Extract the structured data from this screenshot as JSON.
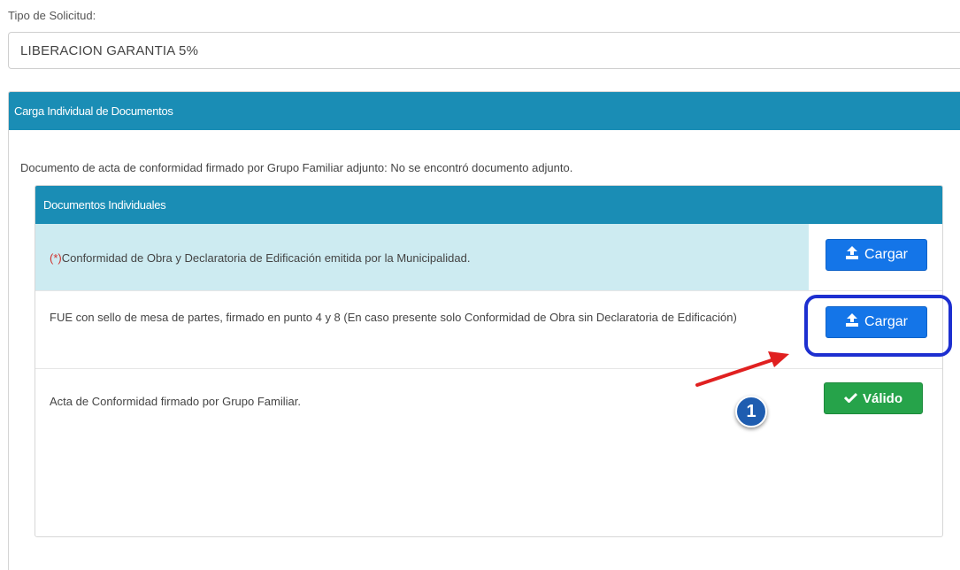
{
  "form": {
    "tipo_label": "Tipo de Solicitud:",
    "tipo_value": "LIBERACION GARANTIA 5%"
  },
  "carga_panel": {
    "title": "Carga Individual de Documentos",
    "notice": "Documento de acta de conformidad firmado por Grupo Familiar adjunto: No se encontró documento adjunto."
  },
  "docs_panel": {
    "title": "Documentos Individuales",
    "rows": [
      {
        "required_mark": "(*)",
        "text": "Conformidad de Obra y Declaratoria de Edificación emitida por la Municipalidad.",
        "button_label": "Cargar",
        "button_icon": "upload-icon"
      },
      {
        "required_mark": "",
        "text": "FUE con sello de mesa de partes, firmado en punto 4 y 8 (En caso presente solo Conformidad de Obra sin Declaratoria de Edificación)",
        "button_label": "Cargar",
        "button_icon": "upload-icon"
      },
      {
        "required_mark": "",
        "text": "Acta de Conformidad firmado por Grupo Familiar.",
        "button_label": "Válido",
        "button_icon": "check-icon"
      }
    ]
  },
  "annotation": {
    "step_number": "1"
  },
  "colors": {
    "panel_header": "#1a8db5",
    "highlight_row": "#cdebf1",
    "button_blue": "#1475e8",
    "button_green": "#26a34a",
    "annotation_ring": "#1d2fd0",
    "arrow": "#e02020",
    "required_mark": "#d0312d"
  }
}
